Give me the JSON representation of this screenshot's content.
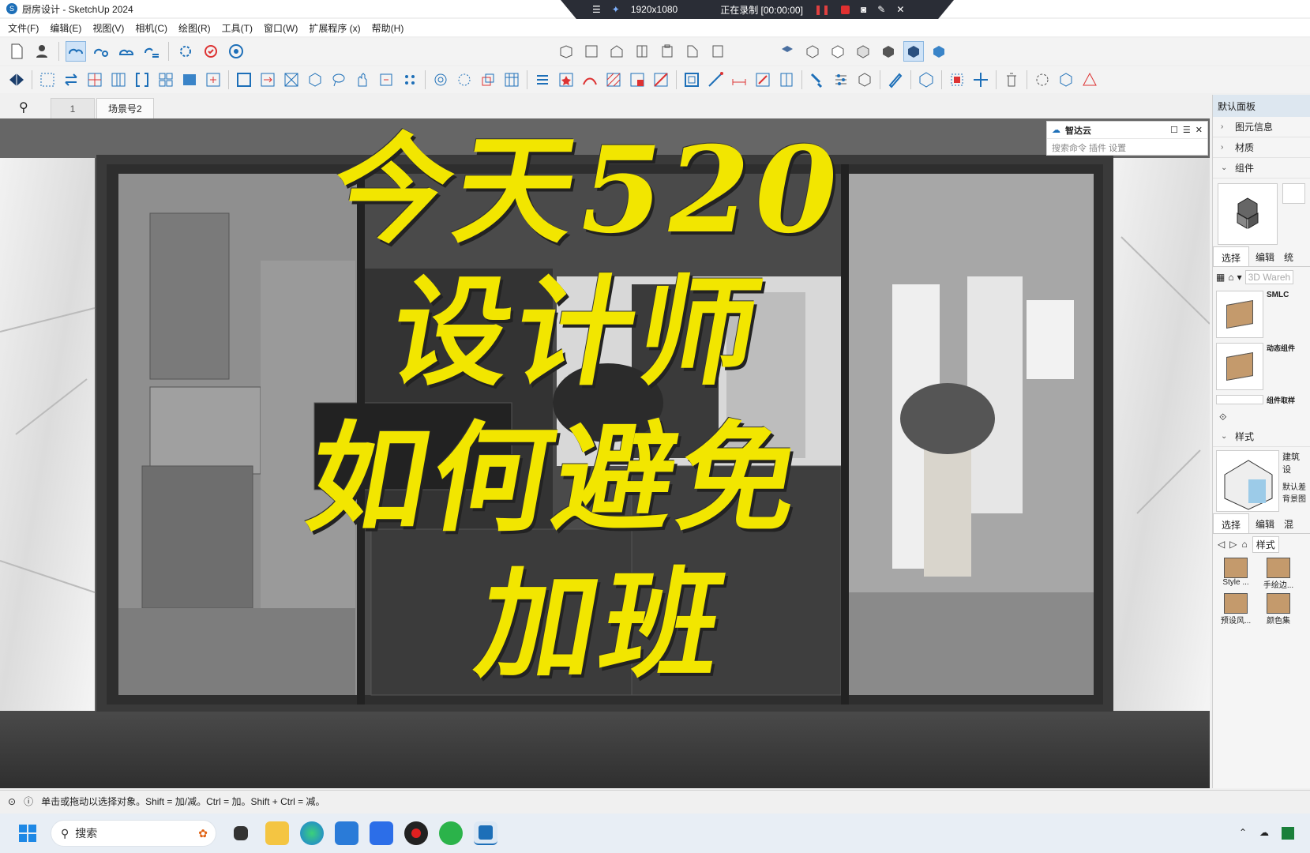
{
  "window": {
    "title": "厨房设计 - SketchUp 2024"
  },
  "recorder": {
    "resolution": "1920x1080",
    "status": "正在录制 [00:00:00]"
  },
  "menu": [
    "文件(F)",
    "编辑(E)",
    "视图(V)",
    "相机(C)",
    "绘图(R)",
    "工具(T)",
    "窗口(W)",
    "扩展程序 (x)",
    "帮助(H)"
  ],
  "scenes": {
    "tab1": "1",
    "tab2": "场景号2"
  },
  "overlay": {
    "line1": "今天520",
    "line2": "设计师",
    "line3": "如何避免",
    "line4": "加班"
  },
  "floating_panel": {
    "title": "智达云",
    "menu_items": "搜索命令  插件  设置"
  },
  "right_panel": {
    "header": "默认面板",
    "trays": [
      "图元信息",
      "材质",
      "组件"
    ],
    "component_tabs": [
      "选择",
      "编辑",
      "统"
    ],
    "search_placeholder": "3D Wareh",
    "component_items": [
      "SMLC",
      "动态组件",
      "组件取样"
    ],
    "styles_header": "样式",
    "style_name": "建筑设",
    "style_desc": "默认差 背景图",
    "style_tabs": [
      "选择",
      "编辑",
      "混"
    ],
    "style_folder": "样式",
    "style_items": [
      "Style ...",
      "手绘边...",
      "预设风...",
      "颜色集"
    ]
  },
  "status": {
    "text": "单击或拖动以选择对象。Shift = 加/减。Ctrl = 加。Shift + Ctrl = 减。"
  },
  "taskbar": {
    "search": "搜索"
  },
  "colors": {
    "overlay_text": "#f2e600",
    "accent": "#1d6fb8"
  }
}
